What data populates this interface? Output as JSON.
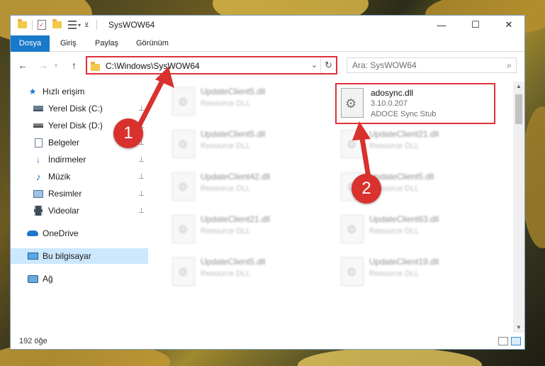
{
  "window": {
    "title": "SysWOW64",
    "controls": {
      "minimize": "—",
      "maximize": "☐",
      "close": "✕"
    }
  },
  "ribbon": {
    "tabs": [
      "Dosya",
      "Giriş",
      "Paylaş",
      "Görünüm"
    ]
  },
  "navigation": {
    "back": "←",
    "forward": "→",
    "up": "↑",
    "address": "C:\\Windows\\SysWOW64",
    "refresh": "↻",
    "dropdown": "⌄",
    "search_placeholder": "Ara: SysWOW64"
  },
  "sidebar": {
    "items": [
      {
        "label": "Hızlı erişim",
        "icon": "star-icon",
        "pinned": false
      },
      {
        "label": "Yerel Disk (C:)",
        "icon": "drive-icon",
        "pinned": true
      },
      {
        "label": "Yerel Disk (D:)",
        "icon": "drive-icon",
        "pinned": true
      },
      {
        "label": "Belgeler",
        "icon": "document-icon",
        "pinned": true
      },
      {
        "label": "İndirmeler",
        "icon": "download-icon",
        "pinned": true
      },
      {
        "label": "Müzik",
        "icon": "music-icon",
        "pinned": true
      },
      {
        "label": "Resimler",
        "icon": "picture-icon",
        "pinned": true
      },
      {
        "label": "Videolar",
        "icon": "video-icon",
        "pinned": true
      },
      {
        "label": "OneDrive",
        "icon": "cloud-icon",
        "pinned": false
      },
      {
        "label": "Bu bilgisayar",
        "icon": "computer-icon",
        "pinned": false,
        "selected": true
      },
      {
        "label": "Ağ",
        "icon": "network-icon",
        "pinned": false
      }
    ],
    "pin_glyph": "📌"
  },
  "files": {
    "background": [
      {
        "name": "UpdateClient5.dll",
        "desc": "Resource DLL"
      },
      {
        "name": "UpdateClient5.dll",
        "desc": "Resource DLL"
      },
      {
        "name": "UpdateClient21.dll",
        "desc": "Resource DLL"
      },
      {
        "name": "UpdateClient42.dll",
        "desc": "Resource DLL"
      },
      {
        "name": "UpdateClient5.dll",
        "desc": "Resource DLL"
      },
      {
        "name": "UpdateClient21.dll",
        "desc": "Resource DLL"
      },
      {
        "name": "UpdateClient63.dll",
        "desc": "Resource DLL"
      },
      {
        "name": "UpdateClient5.dll",
        "desc": "Resource DLL"
      },
      {
        "name": "UpdateClient19.dll",
        "desc": "Resource DLL"
      }
    ],
    "highlighted": {
      "name": "adosync.dll",
      "version": "3.10.0.207",
      "description": "ADOCE Sync Stub"
    }
  },
  "status": {
    "item_count": "192 öğe"
  },
  "annotations": {
    "step1": "1",
    "step2": "2",
    "color": "#d8312e"
  }
}
